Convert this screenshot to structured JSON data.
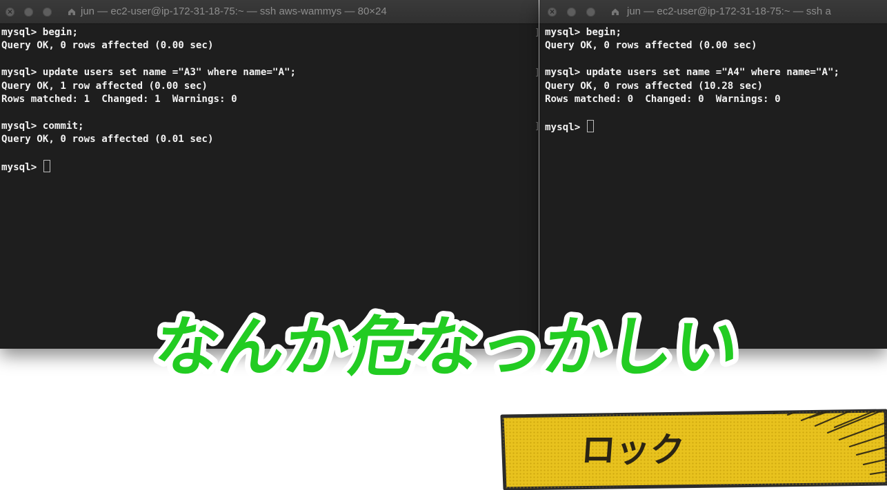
{
  "windows": {
    "left": {
      "title": "jun — ec2-user@ip-172-31-18-75:~ — ssh aws-wammys — 80×24",
      "lines": [
        {
          "text": "mysql> begin;",
          "mark": true
        },
        {
          "text": "Query OK, 0 rows affected (0.00 sec)",
          "mark": false
        },
        {
          "text": "",
          "mark": false
        },
        {
          "text": "mysql> update users set name =\"A3\" where name=\"A\";",
          "mark": true
        },
        {
          "text": "Query OK, 1 row affected (0.00 sec)",
          "mark": false
        },
        {
          "text": "Rows matched: 1  Changed: 1  Warnings: 0",
          "mark": false
        },
        {
          "text": "",
          "mark": false
        },
        {
          "text": "mysql> commit;",
          "mark": true
        },
        {
          "text": "Query OK, 0 rows affected (0.01 sec)",
          "mark": false
        },
        {
          "text": "",
          "mark": false
        }
      ],
      "prompt": "mysql> "
    },
    "right": {
      "title": "jun — ec2-user@ip-172-31-18-75:~ — ssh a",
      "lines": [
        {
          "text": "mysql> begin;",
          "mark": true
        },
        {
          "text": "Query OK, 0 rows affected (0.00 sec)",
          "mark": false
        },
        {
          "text": "",
          "mark": false
        },
        {
          "text": "mysql> update users set name =\"A4\" where name=\"A\";",
          "mark": true
        },
        {
          "text": "Query OK, 0 rows affected (10.28 sec)",
          "mark": false
        },
        {
          "text": "Rows matched: 0  Changed: 0  Warnings: 0",
          "mark": false
        },
        {
          "text": "",
          "mark": false
        }
      ],
      "prompt": "mysql> "
    }
  },
  "caption": {
    "text": "なんか危なっかしい",
    "fill_color": "#22cc22",
    "outline_color": "#ffffff"
  },
  "banner": {
    "label": "ロック",
    "bg_color": "#e8c21e",
    "text_color": "#2a2414",
    "border_color": "#2b2b2b"
  },
  "icons": {
    "traffic_lights": [
      "close-icon",
      "minimize-icon",
      "zoom-icon"
    ],
    "title_icon": "home-folder-icon"
  },
  "colors": {
    "terminal_bg": "#1e1e1e",
    "terminal_text": "#f2f2f2",
    "titlebar_bg": "#353535",
    "titlebar_text": "#8d8d8d"
  }
}
